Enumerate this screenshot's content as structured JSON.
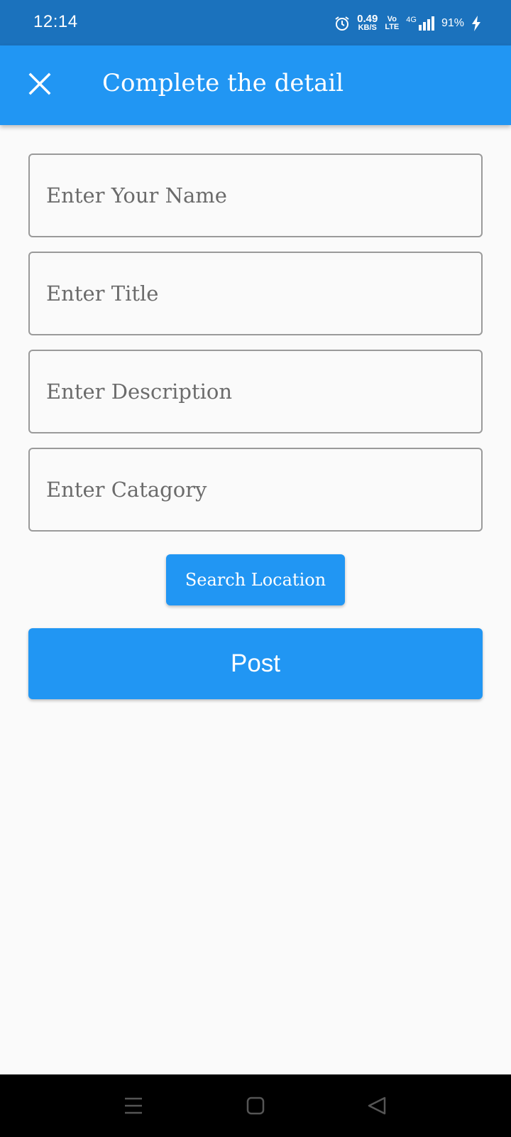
{
  "status_bar": {
    "time": "12:14",
    "net_speed_value": "0.49",
    "net_speed_unit": "KB/S",
    "volte_top": "Vo",
    "volte_bottom": "LTE",
    "network": "4G",
    "battery": "91%"
  },
  "app_bar": {
    "title": "Complete the detail",
    "close_icon": "close-icon"
  },
  "form": {
    "name_placeholder": "Enter Your Name",
    "title_placeholder": "Enter Title",
    "description_placeholder": "Enter Description",
    "category_placeholder": "Enter Catagory",
    "search_location_label": "Search Location",
    "post_label": "Post"
  },
  "nav_bar": {
    "icons": [
      "menu-icon",
      "home-icon",
      "back-icon"
    ]
  },
  "colors": {
    "status_bar": "#1b72bd",
    "primary": "#2196f3",
    "background": "#fafafa",
    "field_border": "#9a9a9a"
  }
}
